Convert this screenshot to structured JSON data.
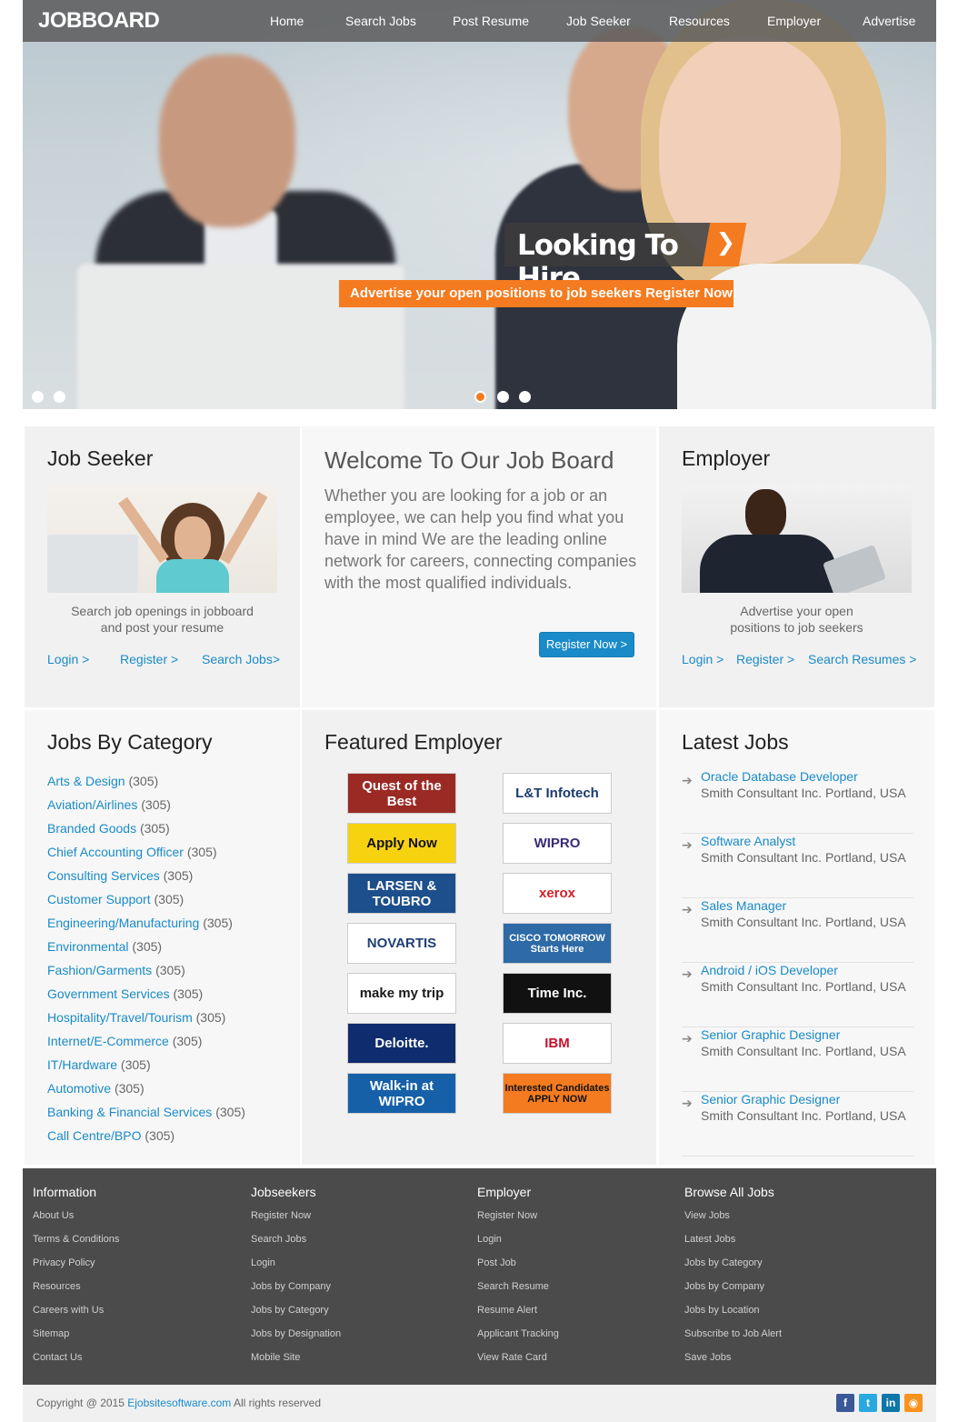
{
  "brand": "JOBBOARD",
  "nav": [
    "Home",
    "Search Jobs",
    "Post Resume",
    "Job Seeker",
    "Resources",
    "Employer",
    "Advertise"
  ],
  "hero": {
    "title": "Looking To Hire",
    "subtitle": "Advertise your open positions to job seekers Register Now!",
    "arrow": "❯"
  },
  "job_seeker": {
    "title": "Job Seeker",
    "desc_line1": "Search job openings in jobboard",
    "desc_line2": "and post your resume",
    "links": [
      "Login >",
      "Register >",
      "Search Jobs>"
    ]
  },
  "welcome": {
    "title": "Welcome To Our Job Board",
    "text": "Whether you are looking for a job or an employee, we can help you find what you have in mind We are the leading online network for careers, connecting companies with the most qualified individuals.",
    "button": "Register Now >"
  },
  "employer": {
    "title": "Employer",
    "desc_line1": "Advertise your open",
    "desc_line2": "positions to job seekers",
    "links": [
      "Login >",
      "Register >",
      "Search Resumes >"
    ]
  },
  "categories": {
    "title": "Jobs By Category",
    "items": [
      {
        "name": "Arts & Design",
        "count": "(305)"
      },
      {
        "name": "Aviation/Airlines",
        "count": "(305)"
      },
      {
        "name": "Branded Goods",
        "count": "(305)"
      },
      {
        "name": "Chief Accounting Officer",
        "count": "(305)"
      },
      {
        "name": "Consulting Services",
        "count": "(305)"
      },
      {
        "name": "Customer Support",
        "count": "(305)"
      },
      {
        "name": "Engineering/Manufacturing",
        "count": "(305)"
      },
      {
        "name": "Environmental",
        "count": "(305)"
      },
      {
        "name": "Fashion/Garments",
        "count": "(305)"
      },
      {
        "name": "Government Services",
        "count": "(305)"
      },
      {
        "name": "Hospitality/Travel/Tourism",
        "count": "(305)"
      },
      {
        "name": "Internet/E-Commerce",
        "count": "(305)"
      },
      {
        "name": "IT/Hardware",
        "count": "(305)"
      },
      {
        "name": "Automotive",
        "count": "(305)"
      },
      {
        "name": "Banking & Financial Services",
        "count": "(305)"
      },
      {
        "name": "Call Centre/BPO",
        "count": "(305)"
      }
    ]
  },
  "featured": {
    "title": "Featured Employer",
    "logos": [
      {
        "text": "Quest of the Best",
        "bg": "#9b2a25",
        "fg": "#ffffff"
      },
      {
        "text": "L&T Infotech",
        "bg": "#ffffff",
        "fg": "#1a3a6e"
      },
      {
        "text": "Apply Now",
        "bg": "#f7d211",
        "fg": "#111111"
      },
      {
        "text": "WIPRO",
        "bg": "#ffffff",
        "fg": "#3b2a7a"
      },
      {
        "text": "LARSEN & TOUBRO",
        "bg": "#1d4f8c",
        "fg": "#ffffff"
      },
      {
        "text": "xerox",
        "bg": "#ffffff",
        "fg": "#d3202a"
      },
      {
        "text": "NOVARTIS",
        "bg": "#ffffff",
        "fg": "#1f3f73"
      },
      {
        "text": "CISCO  TOMORROW Starts Here",
        "bg": "#2d6aa6",
        "fg": "#ffffff"
      },
      {
        "text": "make my trip",
        "bg": "#ffffff",
        "fg": "#1a1a1a"
      },
      {
        "text": "Time Inc.",
        "bg": "#111111",
        "fg": "#ffffff"
      },
      {
        "text": "Deloitte.",
        "bg": "#0f2d6e",
        "fg": "#ffffff"
      },
      {
        "text": "IBM",
        "bg": "#ffffff",
        "fg": "#c8102e"
      },
      {
        "text": "Walk-in at WIPRO",
        "bg": "#1560a8",
        "fg": "#ffffff"
      },
      {
        "text": "Interested Candidates APPLY NOW",
        "bg": "#f47b20",
        "fg": "#111111"
      }
    ]
  },
  "latest": {
    "title": "Latest Jobs",
    "jobs": [
      {
        "title": "Oracle Database Developer",
        "company": "Smith Consultant Inc. Portland, USA"
      },
      {
        "title": "Software Analyst",
        "company": "Smith Consultant Inc. Portland, USA"
      },
      {
        "title": "Sales Manager",
        "company": "Smith Consultant Inc. Portland, USA"
      },
      {
        "title": "Android / iOS Developer",
        "company": "Smith Consultant Inc. Portland, USA"
      },
      {
        "title": "Senior Graphic Designer",
        "company": "Smith Consultant Inc. Portland, USA"
      },
      {
        "title": "Senior Graphic Designer",
        "company": "Smith Consultant Inc. Portland, USA"
      }
    ]
  },
  "footer": {
    "columns": [
      {
        "title": "Information",
        "links": [
          "About Us",
          "Terms & Conditions",
          "Privacy Policy",
          "Resources",
          "Careers with Us",
          "Sitemap",
          "Contact Us"
        ]
      },
      {
        "title": "Jobseekers",
        "links": [
          "Register Now",
          "Search Jobs",
          "Login",
          "Jobs by Company",
          "Jobs by Category",
          "Jobs by Designation",
          "Mobile Site"
        ]
      },
      {
        "title": "Employer",
        "links": [
          "Register Now",
          "Login",
          "Post Job",
          "Search Resume",
          "Resume Alert",
          "Applicant Tracking",
          "View Rate Card"
        ]
      },
      {
        "title": "Browse All Jobs",
        "links": [
          "View Jobs",
          "Latest Jobs",
          "Jobs by Category",
          "Jobs by Company",
          "Jobs by Location",
          "Subscribe to Job Alert",
          "Save Jobs"
        ]
      }
    ],
    "copyright_prefix": "Copyright @ 2015",
    "copyright_site": "Ejobsitesoftware.com",
    "copyright_suffix": "All rights reserved",
    "social": [
      {
        "icon": "facebook-icon",
        "glyph": "f",
        "color": "#3b5998"
      },
      {
        "icon": "twitter-icon",
        "glyph": "t",
        "color": "#2aa9e0"
      },
      {
        "icon": "linkedin-icon",
        "glyph": "in",
        "color": "#0e76a8"
      },
      {
        "icon": "rss-icon",
        "glyph": "◉",
        "color": "#f7931e"
      }
    ]
  },
  "colors": {
    "accent": "#f47b20",
    "link": "#1a8bc8",
    "footer_bg": "#4b4b4b"
  }
}
